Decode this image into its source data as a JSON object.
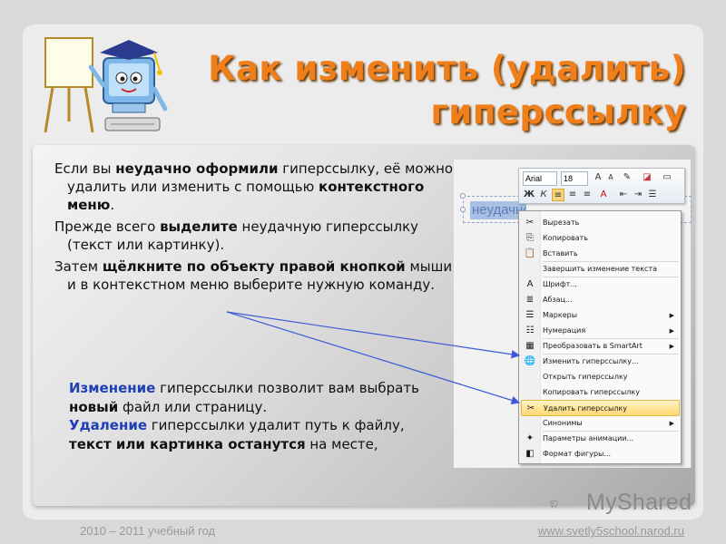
{
  "title": {
    "line1": "Как изменить (удалить)",
    "line2": "гиперссылку"
  },
  "paragraph1": {
    "part1": "Если вы ",
    "bold1": "неудачно оформили",
    "part2": " гиперссылку, её можно удалить или изменить с помощью ",
    "bold2": "контекстного меню",
    "part3": "."
  },
  "paragraph2": {
    "part1": "Прежде всего ",
    "bold1": "выделите",
    "part2": " неудачную гиперссылку (текст или картинку)."
  },
  "paragraph3": {
    "part1": "Затем ",
    "bold1": "щёлкните по объекту правой кнопкой",
    "part2": " мыши и в контекстном меню выберите нужную команду."
  },
  "note": {
    "edit_word": "Изменение",
    "edit_text1": " гиперссылки позволит вам выбрать ",
    "edit_bold": "новый",
    "edit_text2": " файл или страницу.",
    "delete_word": "Удаление",
    "delete_text1": " гиперссылки удалит путь к файлу, ",
    "delete_bold": "текст или картинка останутся",
    "delete_text2": " на месте,"
  },
  "screenshot": {
    "hyperlink_text": "неудачно",
    "toolbar": {
      "font": "Arial",
      "size": "18"
    },
    "menu_items": [
      {
        "label": "Вырезать",
        "icon": "scissors-icon",
        "glyph": "✂",
        "submenu": false
      },
      {
        "label": "Копировать",
        "icon": "copy-icon",
        "glyph": "⎘",
        "submenu": false
      },
      {
        "label": "Вставить",
        "icon": "paste-icon",
        "glyph": "📋",
        "submenu": false
      },
      {
        "label": "Завершить изменение текста",
        "icon": "",
        "glyph": "",
        "submenu": false
      },
      {
        "label": "Шрифт...",
        "icon": "font-icon",
        "glyph": "A",
        "submenu": false
      },
      {
        "label": "Абзац...",
        "icon": "paragraph-icon",
        "glyph": "≣",
        "submenu": false
      },
      {
        "label": "Маркеры",
        "icon": "bullets-icon",
        "glyph": "☰",
        "submenu": true
      },
      {
        "label": "Нумерация",
        "icon": "numbering-icon",
        "glyph": "☷",
        "submenu": true
      },
      {
        "label": "Преобразовать в SmartArt",
        "icon": "smartart-icon",
        "glyph": "▦",
        "submenu": true
      },
      {
        "label": "Изменить гиперссылку...",
        "icon": "hyperlink-edit-icon",
        "glyph": "🌐",
        "submenu": false
      },
      {
        "label": "Открыть гиперссылку",
        "icon": "",
        "glyph": "",
        "submenu": false
      },
      {
        "label": "Копировать гиперссылку",
        "icon": "",
        "glyph": "",
        "submenu": false
      },
      {
        "label": "Удалить гиперссылку",
        "icon": "hyperlink-remove-icon",
        "glyph": "✂",
        "submenu": false,
        "highlighted": true
      },
      {
        "label": "Синонимы",
        "icon": "",
        "glyph": "",
        "submenu": true
      },
      {
        "label": "Параметры анимации...",
        "icon": "animation-icon",
        "glyph": "✦",
        "submenu": false
      },
      {
        "label": "Формат фигуры...",
        "icon": "shape-format-icon",
        "glyph": "◧",
        "submenu": false
      }
    ]
  },
  "logo": "MyShared",
  "footer": {
    "year": "2010 – 2011 учебный год",
    "url": "www.svetly5school.narod.ru"
  },
  "colors": {
    "title": "#ef7f1a",
    "accent_blue": "#1f3fb5",
    "arrow": "#3d5bd6",
    "highlight": "#ffd870"
  }
}
